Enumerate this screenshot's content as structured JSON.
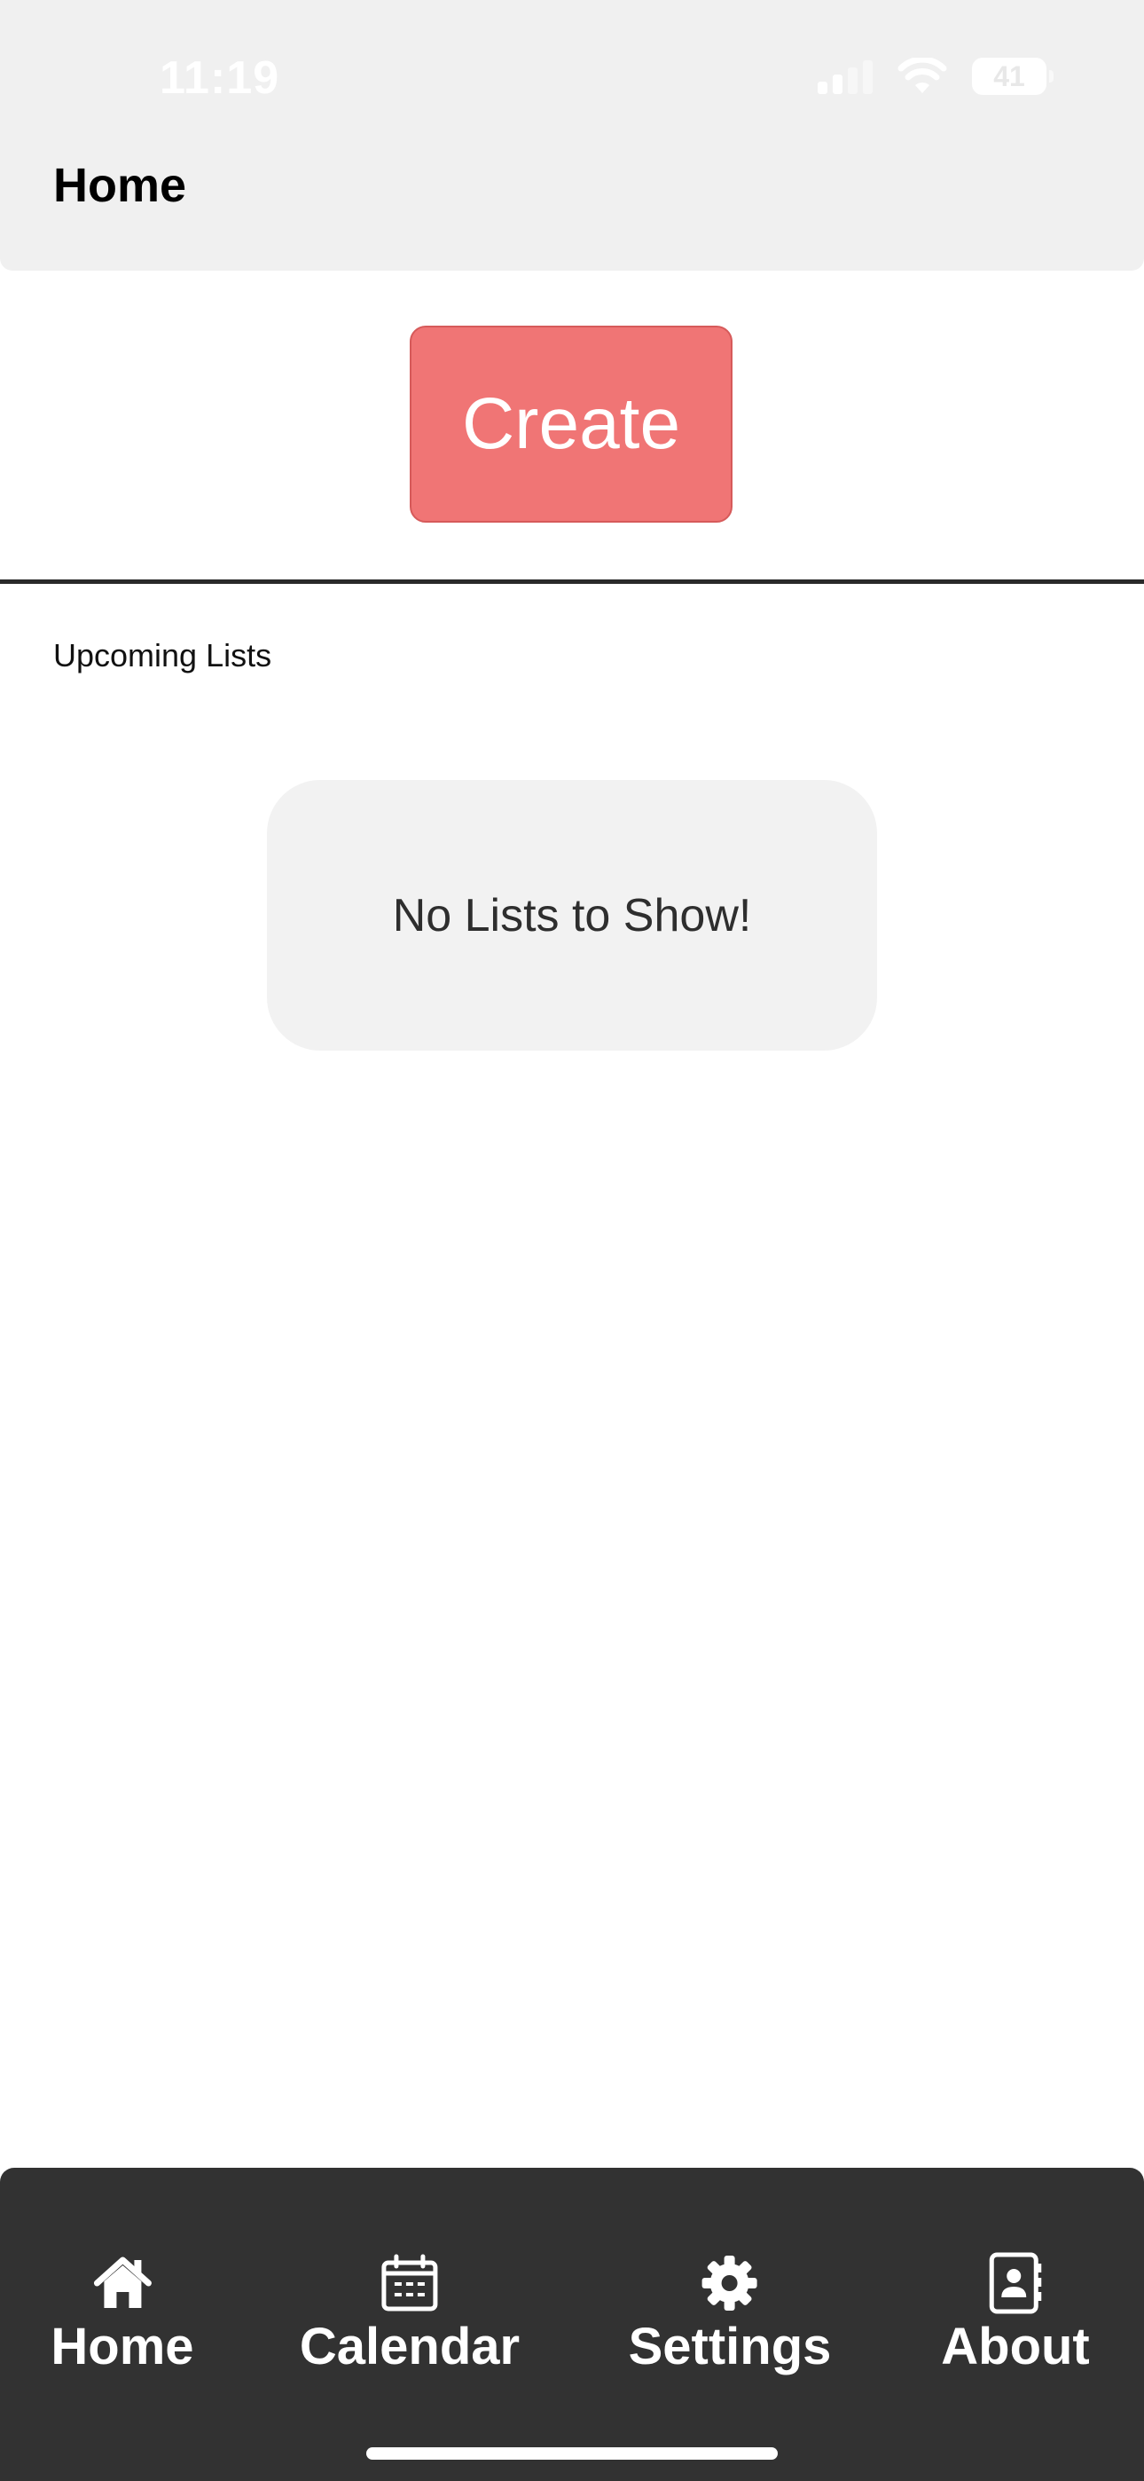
{
  "status_bar": {
    "time": "11:19",
    "battery": "41"
  },
  "header": {
    "title": "Home"
  },
  "create_label": "Create",
  "upcoming": {
    "heading": "Upcoming Lists",
    "empty_message": "No Lists to Show!"
  },
  "tabs": [
    {
      "label": "Home",
      "icon": "home-icon"
    },
    {
      "label": "Calendar",
      "icon": "calendar-icon"
    },
    {
      "label": "Settings",
      "icon": "gear-icon"
    },
    {
      "label": "About",
      "icon": "contact-book-icon"
    }
  ],
  "colors": {
    "accent": "#f07575",
    "header_bg": "#f0f0f0",
    "tabbar_bg": "#323232"
  }
}
